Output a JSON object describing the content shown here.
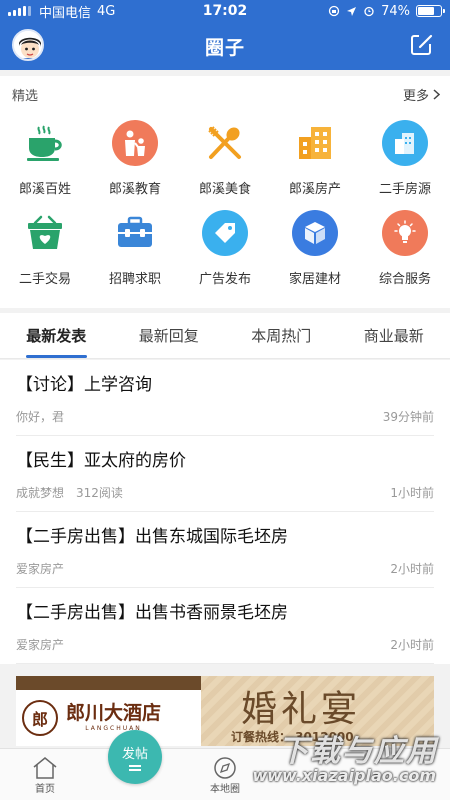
{
  "status_bar": {
    "carrier": "中国电信",
    "network": "4G",
    "time": "17:02",
    "battery": "74%",
    "battery_level": 0.74
  },
  "header": {
    "title": "圈子",
    "accent_color": "#2f6fd0"
  },
  "featured": {
    "title": "精选",
    "more_label": "更多",
    "items": [
      {
        "label": "郎溪百姓",
        "icon": "teacup-icon",
        "color": "#2aa36b"
      },
      {
        "label": "郎溪教育",
        "icon": "family-icon",
        "color": "#f07a5a"
      },
      {
        "label": "郎溪美食",
        "icon": "fork-spoon-icon",
        "color": "#f2a020"
      },
      {
        "label": "郎溪房产",
        "icon": "building-icon",
        "color": "#f2a020"
      },
      {
        "label": "二手房源",
        "icon": "house-icon",
        "color": "#3ab0ee"
      },
      {
        "label": "二手交易",
        "icon": "basket-icon",
        "color": "#2aa36b"
      },
      {
        "label": "招聘求职",
        "icon": "briefcase-icon",
        "color": "#3a86d8"
      },
      {
        "label": "广告发布",
        "icon": "tag-icon",
        "color": "#3ab0ee"
      },
      {
        "label": "家居建材",
        "icon": "box-icon",
        "color": "#3a7ce0"
      },
      {
        "label": "综合服务",
        "icon": "bulb-icon",
        "color": "#f07a5a"
      }
    ]
  },
  "tabs": [
    {
      "label": "最新发表",
      "active": true
    },
    {
      "label": "最新回复",
      "active": false
    },
    {
      "label": "本周热门",
      "active": false
    },
    {
      "label": "商业最新",
      "active": false
    }
  ],
  "posts": [
    {
      "title": "【讨论】上学咨询",
      "author": "你好，君",
      "views": "",
      "time": "39分钟前"
    },
    {
      "title": "【民生】亚太府的房价",
      "author": "成就梦想",
      "views": "312阅读",
      "time": "1小时前"
    },
    {
      "title": "【二手房出售】出售东城国际毛坯房",
      "author": "爱家房产",
      "views": "",
      "time": "2小时前"
    },
    {
      "title": "【二手房出售】出售书香丽景毛坯房",
      "author": "爱家房产",
      "views": "",
      "time": "2小时前"
    }
  ],
  "banner": {
    "hotel_name": "郎川大酒店",
    "hotel_en": "LANGCHUAN",
    "headline": "婚礼宴",
    "phone_text": "订餐热线：  3012000"
  },
  "bottom_nav": {
    "home_label": "首页",
    "post_label": "发帖",
    "local_label": "本地圈"
  },
  "watermark": {
    "text": "下载与应用",
    "url": "www.xiazaiplao.com"
  }
}
